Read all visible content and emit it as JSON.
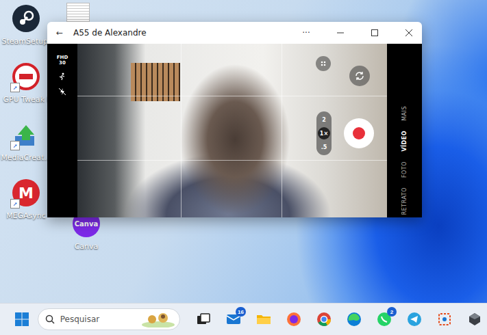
{
  "desktop": {
    "icons": [
      {
        "label": "SteamSetup.",
        "kind": "steam",
        "logo": ""
      },
      {
        "label": "GPU Tweak I",
        "kind": "gpu",
        "logo": ""
      },
      {
        "label": "MediaCreat...",
        "kind": "media",
        "logo": ""
      },
      {
        "label": "MEGAsync",
        "kind": "mega",
        "logo": "M"
      },
      {
        "label": "Canva",
        "kind": "canva",
        "logo": "Canva"
      }
    ]
  },
  "window": {
    "title": "A55 de Alexandre",
    "back": "←",
    "more": "···"
  },
  "camera": {
    "quality": "FHD",
    "fps": "30",
    "zoom": [
      {
        "label": "2",
        "selected": false
      },
      {
        "label": "1×",
        "selected": true
      },
      {
        "label": ".5",
        "selected": false
      }
    ],
    "modes": [
      {
        "label": "MAIS",
        "selected": false
      },
      {
        "label": "VÍDEO",
        "selected": true
      },
      {
        "label": "FOTO",
        "selected": false
      },
      {
        "label": "RETRATO",
        "selected": false
      }
    ],
    "recording": false
  },
  "taskbar": {
    "search": {
      "placeholder": "Pesquisar"
    },
    "apps": [
      {
        "kind": "taskview",
        "badge": ""
      },
      {
        "kind": "mail",
        "badge": "16"
      },
      {
        "kind": "explorer",
        "badge": ""
      },
      {
        "kind": "firefox",
        "badge": ""
      },
      {
        "kind": "chrome",
        "badge": ""
      },
      {
        "kind": "edge",
        "badge": ""
      },
      {
        "kind": "whatsapp",
        "badge": "2"
      },
      {
        "kind": "telegram",
        "badge": ""
      },
      {
        "kind": "snip",
        "badge": ""
      },
      {
        "kind": "box",
        "badge": ""
      }
    ]
  }
}
